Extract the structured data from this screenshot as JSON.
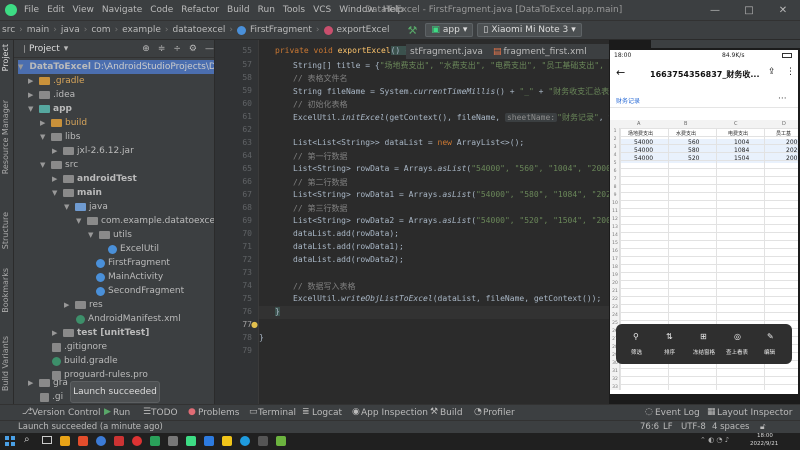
{
  "titlebar": {
    "menu": [
      "File",
      "Edit",
      "View",
      "Navigate",
      "Code",
      "Refactor",
      "Build",
      "Run",
      "Tools",
      "VCS",
      "Window",
      "Help"
    ],
    "window_title": "DataToExcel - FirstFragment.java [DataToExcel.app.main]"
  },
  "navbar": {
    "crumbs": [
      "src",
      "main",
      "java",
      "com",
      "example",
      "datatoexcel"
    ],
    "class_name": "FirstFragment",
    "method_name": "exportExcel",
    "run_config": "app",
    "device": "Xiaomi Mi Note 3"
  },
  "side_tabs": {
    "left": [
      "Project",
      "Resource Manager",
      "Structure",
      "Bookmarks",
      "Build Variants"
    ]
  },
  "project_panel": {
    "title": "Project",
    "tree": [
      {
        "label": "DataToExcel",
        "extra": "D:\\AndroidStudioProjects\\DataTo",
        "bold": true
      },
      {
        "label": ".gradle"
      },
      {
        "label": ".idea"
      },
      {
        "label": "app",
        "bold": true
      },
      {
        "label": "build"
      },
      {
        "label": "libs"
      },
      {
        "label": "jxl-2.6.12.jar"
      },
      {
        "label": "src"
      },
      {
        "label": "androidTest",
        "bold": true
      },
      {
        "label": "main",
        "bold": true
      },
      {
        "label": "java"
      },
      {
        "label": "com.example.datatoexcel"
      },
      {
        "label": "utils"
      },
      {
        "label": "ExcelUtil"
      },
      {
        "label": "FirstFragment"
      },
      {
        "label": "MainActivity"
      },
      {
        "label": "SecondFragment"
      },
      {
        "label": "res"
      },
      {
        "label": "AndroidManifest.xml"
      },
      {
        "label": "test [unitTest]",
        "bold": true
      },
      {
        "label": ".gitignore"
      },
      {
        "label": "build.gradle"
      },
      {
        "label": "proguard-rules.pro"
      },
      {
        "label": "gra"
      },
      {
        "label": ".gi"
      }
    ]
  },
  "editor": {
    "tabs": [
      "stFragment.java",
      "fragment_first.xml"
    ],
    "line_numbers": [
      "55",
      "57",
      "58",
      "59",
      "60",
      "61",
      "62",
      "63",
      "64",
      "65",
      "66",
      "67",
      "68",
      "69",
      "70",
      "71",
      "72",
      "73",
      "74",
      "75",
      "76",
      "77",
      "78",
      "79"
    ],
    "current_line": "76",
    "code": {
      "l55a": "private void ",
      "l55b": "exportExcel",
      "l55c": "() {",
      "l57a": "String[] title = {",
      "l57b": "\"场地费支出\", \"水费支出\", \"电费支出\", \"员工基础支出\", \"",
      "l58": "// 表格文件名",
      "l59a": "String fileName = System.",
      "l59b": "currentTimeMillis",
      "l59c": "() + ",
      "l59d": "\"_\"",
      "l59e": " + ",
      "l59f": "\"财务收支汇总表.xls\"",
      "l60": "// 初始化表格",
      "l61a": "ExcelUtil.",
      "l61b": "initExcel",
      "l61c": "(getContext(), fileName, ",
      "l61d": "sheetName:",
      "l61e": "\"财务记录\"",
      "l61f": ", tit",
      "l63a": "List<List<String>> dataList = ",
      "l63b": "new ",
      "l63c": "ArrayList<>();",
      "l64": "// 第一行数据",
      "l65a": "List<String> rowData = Arrays.",
      "l65b": "asList",
      "l65c": "(",
      "l65d": "\"54000\", \"560\", \"1004\", \"20000\"",
      "l66": "// 第二行数据",
      "l67a": "List<String> rowData1 = Arrays.",
      "l67b": "asList",
      "l67c": "(",
      "l67d": "\"54000\", \"580\", \"1084\", \"2020\"",
      "l68": "// 第三行数据",
      "l69a": "List<String> rowData2 = Arrays.",
      "l69b": "asList",
      "l69c": "(",
      "l69d": "\"54000\", \"520\", \"1504\", \"2007\"",
      "l70": "dataList.add(rowData);",
      "l71": "dataList.add(rowData1);",
      "l72": "dataList.add(rowData2);",
      "l74": "// 数据写入表格",
      "l75a": "ExcelUtil.",
      "l75b": "writeObjListToExcel",
      "l75c": "(dataList, fileName, getContext());",
      "l76": "}",
      "l78": "}"
    }
  },
  "phone": {
    "status_time": "18:00",
    "status_right": "84.9K/s",
    "file_title": "1663754356837_财务收...",
    "sheet_tab": "财务记录",
    "col_letters": [
      "A",
      "B",
      "C",
      "D"
    ],
    "headers": [
      "场地费支出",
      "水费支出",
      "电费支出",
      "员工基"
    ],
    "rows": [
      [
        "54000",
        "560",
        "1004",
        "2000"
      ],
      [
        "54000",
        "580",
        "1084",
        "2020"
      ],
      [
        "54000",
        "520",
        "1504",
        "2007"
      ]
    ],
    "row_numbers": [
      "1",
      "2",
      "3",
      "4",
      "5",
      "6",
      "7",
      "8",
      "9",
      "10",
      "11",
      "12",
      "13",
      "14",
      "15",
      "16",
      "17",
      "18",
      "19",
      "20",
      "21",
      "22",
      "23",
      "24",
      "25",
      "26",
      "27",
      "28",
      "29",
      "30",
      "31",
      "32",
      "33",
      "34",
      "35",
      "36"
    ],
    "toolbar": [
      "筛选",
      "排序",
      "冻结窗格",
      "查上看表",
      "编辑"
    ]
  },
  "toast": "Launch succeeded",
  "toolwindows": [
    "Version Control",
    "Run",
    "TODO",
    "Problems",
    "Terminal",
    "Logcat",
    "App Inspection",
    "Build",
    "Profiler",
    "Event Log",
    "Layout Inspector"
  ],
  "status": {
    "message": "Launch succeeded (a minute ago)",
    "position": "76:6",
    "line_sep": "LF",
    "encoding": "UTF-8",
    "indent": "4 spaces"
  },
  "taskbar": {
    "time": "18:00",
    "date": "2022/9/21"
  }
}
